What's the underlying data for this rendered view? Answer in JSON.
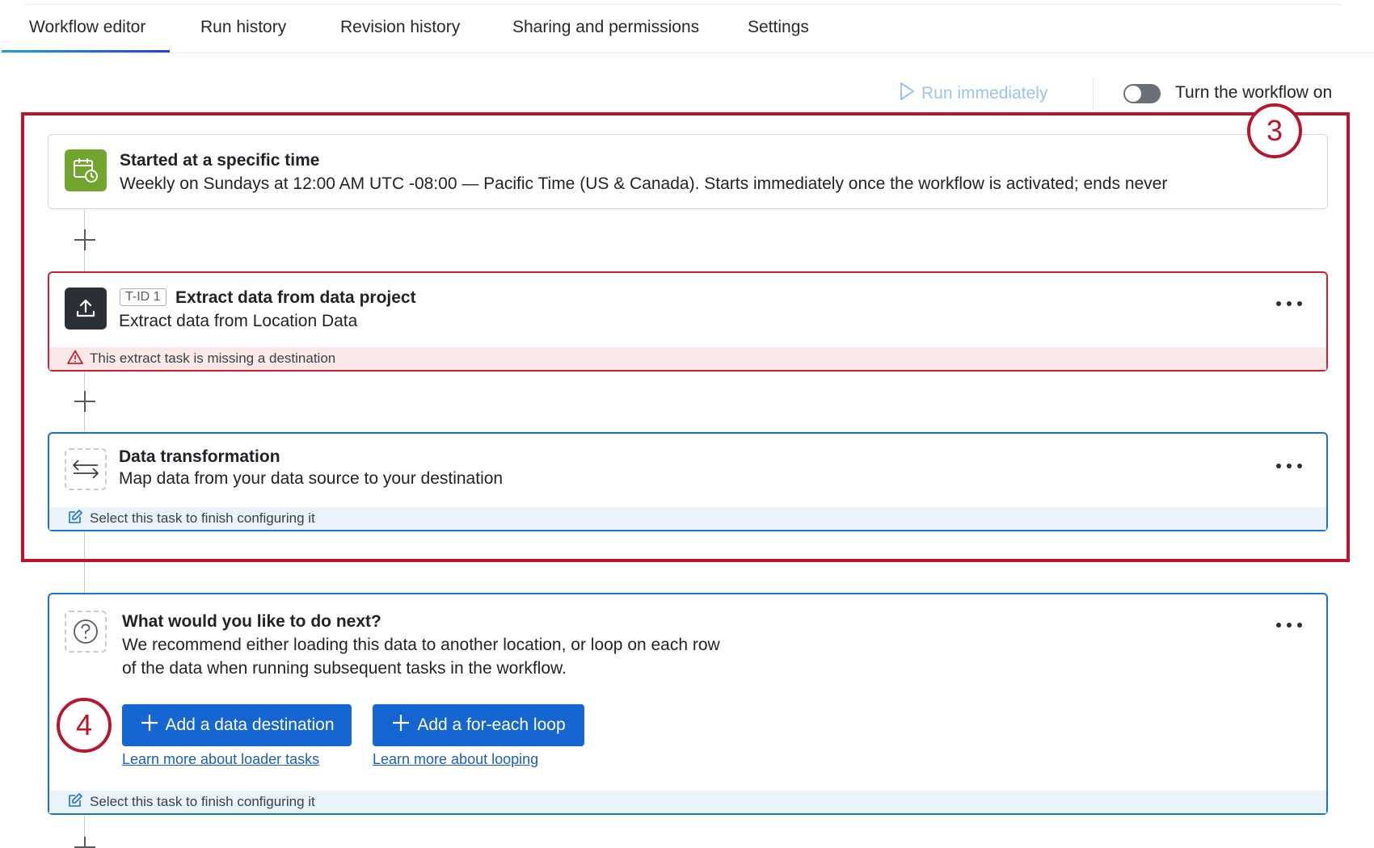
{
  "tabs": [
    {
      "label": "Workflow editor",
      "active": true
    },
    {
      "label": "Run history"
    },
    {
      "label": "Revision history"
    },
    {
      "label": "Sharing and permissions"
    },
    {
      "label": "Settings"
    }
  ],
  "toolbar": {
    "run_label": "Run immediately",
    "toggle_label": "Turn the workflow on",
    "toggle_state": "off"
  },
  "callouts": {
    "first": "3",
    "second": "4"
  },
  "trigger_card": {
    "icon": "calendar-clock-icon",
    "title": "Started at a specific time",
    "description": "Weekly on Sundays at 12:00 AM UTC -08:00 — Pacific Time (US & Canada). Starts immediately once the workflow is activated; ends never"
  },
  "extract_card": {
    "icon": "upload-icon",
    "badge": "T-ID 1",
    "title": "Extract data from data project",
    "description": "Extract data from Location Data",
    "warning": "This extract task is missing a destination"
  },
  "transform_card": {
    "icon": "transform-arrows-icon",
    "title": "Data transformation",
    "description": "Map data from your data source to your destination",
    "footer": "Select this task to finish configuring it"
  },
  "next_card": {
    "icon": "question-icon",
    "title": "What would you like to do next?",
    "description_line1": "We recommend either loading this data to another location, or loop on each row",
    "description_line2": "of the data when running subsequent tasks in the workflow.",
    "add_destination_label": "Add a data destination",
    "add_loop_label": "Add a for-each loop",
    "loader_link": "Learn more about loader tasks",
    "looping_link": "Learn more about looping",
    "footer": "Select this task to finish configuring it"
  },
  "colors": {
    "accent_blue": "#1566d1",
    "error_red": "#cf1f35",
    "annotation_red": "#b4172f",
    "trigger_green": "#70a62d"
  }
}
